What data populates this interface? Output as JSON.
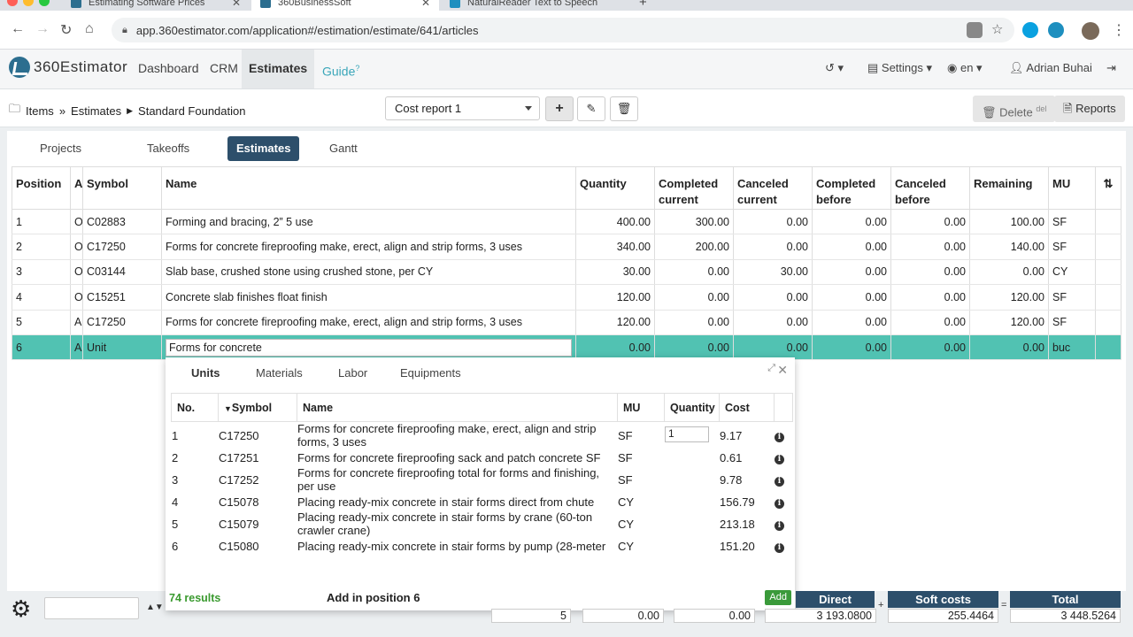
{
  "browser": {
    "tabs": [
      {
        "title": "Estimating Software Prices",
        "favicon_color": "#2c6e8f"
      },
      {
        "title": "360BusinessSoft",
        "favicon_color": "#2c6e8f"
      },
      {
        "title": "NaturalReader Text to Speech",
        "favicon_color": "#1e8fbf"
      }
    ],
    "new_tab": "+",
    "close": "✕",
    "url": "app.360estimator.com/application#/estimation/estimate/641/articles"
  },
  "app": {
    "logo_text": "360Estimator",
    "nav": [
      "Dashboard",
      "CRM",
      "Estimates",
      "Guide"
    ],
    "guide_badge": "?",
    "settings_label": "Settings",
    "language": "en",
    "user": "Adrian Buhai"
  },
  "breadcrumb": {
    "root": "Items",
    "level1": "Estimates",
    "level2": "Standard Foundation"
  },
  "toolbar": {
    "cost_report": "Cost report 1",
    "delete_label": "Delete",
    "delete_shortcut": "del",
    "reports_label": "Reports"
  },
  "subtabs": [
    "Projects",
    "Takeoffs",
    "Estimates",
    "Gantt"
  ],
  "table": {
    "headers": [
      "Position",
      "A",
      "Symbol",
      "Name",
      "Quantity",
      "Completed current",
      "Canceled current",
      "Completed before",
      "Canceled before",
      "Remaining",
      "MU"
    ],
    "rows": [
      [
        "1",
        "O",
        "C02883",
        "Forming and bracing, 2” 5 use",
        "400.00",
        "300.00",
        "0.00",
        "0.00",
        "0.00",
        "100.00",
        "SF"
      ],
      [
        "2",
        "O",
        "C17250",
        "Forms for concrete fireproofing make, erect, align and strip forms, 3 uses",
        "340.00",
        "200.00",
        "0.00",
        "0.00",
        "0.00",
        "140.00",
        "SF"
      ],
      [
        "3",
        "O",
        "C03144",
        "Slab base, crushed stone using crushed stone, per CY",
        "30.00",
        "0.00",
        "30.00",
        "0.00",
        "0.00",
        "0.00",
        "CY"
      ],
      [
        "4",
        "O",
        "C15251",
        "Concrete slab finishes float finish",
        "120.00",
        "0.00",
        "0.00",
        "0.00",
        "0.00",
        "120.00",
        "SF"
      ],
      [
        "5",
        "A",
        "C17250",
        "Forms for concrete fireproofing make, erect, align and strip forms, 3 uses",
        "120.00",
        "0.00",
        "0.00",
        "0.00",
        "0.00",
        "120.00",
        "SF"
      ]
    ],
    "edit_row": {
      "position": "6",
      "a": "A",
      "symbol": "Unit",
      "name_input": "Forms for concrete",
      "quantity": "0.00",
      "completed_current": "0.00",
      "canceled_current": "0.00",
      "completed_before": "0.00",
      "canceled_before": "0.00",
      "remaining": "0.00",
      "mu": "buc"
    }
  },
  "popup": {
    "tabs": [
      "Units",
      "Materials",
      "Labor",
      "Equipments"
    ],
    "headers": [
      "No.",
      "Symbol",
      "Name",
      "MU",
      "Quantity",
      "Cost"
    ],
    "rows": [
      [
        "1",
        "C17250",
        "Forms for concrete fireproofing make, erect, align and strip forms, 3 uses",
        "SF",
        "1",
        "9.17"
      ],
      [
        "2",
        "C17251",
        "Forms for concrete fireproofing sack and patch concrete SF",
        "SF",
        "",
        "0.61"
      ],
      [
        "3",
        "C17252",
        "Forms for concrete fireproofing total for forms and finishing, per use",
        "SF",
        "",
        "9.78"
      ],
      [
        "4",
        "C15078",
        "Placing ready-mix concrete in stair forms direct from chute",
        "CY",
        "",
        "156.79"
      ],
      [
        "5",
        "C15079",
        "Placing ready-mix concrete in stair forms by crane (60-ton crawler crane)",
        "CY",
        "",
        "213.18"
      ],
      [
        "6",
        "C15080",
        "Placing ready-mix concrete in stair forms by pump (28-meter",
        "CY",
        "",
        "151.20"
      ]
    ],
    "results": "74 results",
    "add_position": "Add in position 6",
    "add_button": "Add",
    "info_glyph": "i"
  },
  "footer": {
    "count": "5",
    "total1": "0.00",
    "total2": "0.00",
    "direct_label": "Direct",
    "direct_value": "3 193.0800",
    "soft_label": "Soft costs",
    "soft_value": "255.4464",
    "total_label": "Total",
    "total_value": "3 448.5264",
    "plus": "+",
    "equals": "="
  },
  "colors": {
    "selected_row": "#51c2b2",
    "header_dark": "#2d4f6b",
    "results_green": "#3a9a2f",
    "guide": "#3aa6b9"
  }
}
